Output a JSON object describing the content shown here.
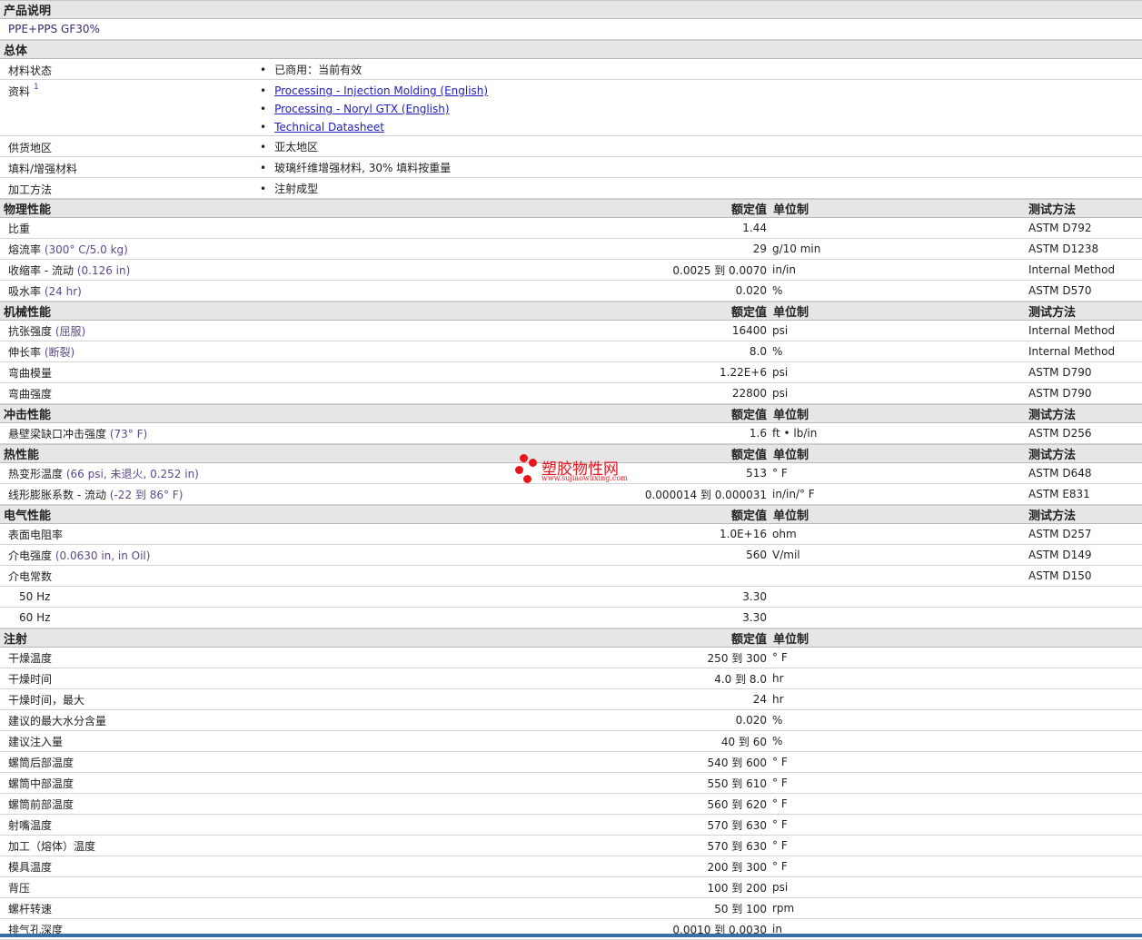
{
  "product": {
    "title": "产品说明",
    "desc": "PPE+PPS GF30%"
  },
  "general": {
    "title": "总体",
    "rows": [
      {
        "name": "材料状态",
        "items": [
          "已商用：当前有效"
        ]
      },
      {
        "name": "资料",
        "sup": "1",
        "links": [
          "Processing - Injection Molding (English)",
          "Processing - Noryl GTX (English)",
          "Technical Datasheet"
        ]
      },
      {
        "name": "供货地区",
        "items": [
          "亚太地区"
        ]
      },
      {
        "name": "填料/增强材料",
        "items": [
          "玻璃纤维增强材料, 30% 填料按重量"
        ]
      },
      {
        "name": "加工方法",
        "items": [
          "注射成型"
        ]
      }
    ]
  },
  "cols": {
    "value": "额定值",
    "unit": "单位制",
    "method": "测试方法"
  },
  "sections": [
    {
      "title": "物理性能",
      "rows": [
        {
          "name": "比重",
          "cond": "",
          "value": "1.44",
          "unit": "",
          "method": "ASTM D792"
        },
        {
          "name": "熔流率",
          "cond": "(300° C/5.0 kg)",
          "value": "29",
          "unit": "g/10 min",
          "method": "ASTM D1238"
        },
        {
          "name": "收缩率 - 流动",
          "cond": "(0.126 in)",
          "value": "0.0025 到 0.0070",
          "unit": "in/in",
          "method": "Internal Method"
        },
        {
          "name": "吸水率",
          "cond": "(24 hr)",
          "value": "0.020",
          "unit": "%",
          "method": "ASTM D570"
        }
      ]
    },
    {
      "title": "机械性能",
      "rows": [
        {
          "name": "抗张强度",
          "cond": "(屈服)",
          "value": "16400",
          "unit": "psi",
          "method": "Internal Method"
        },
        {
          "name": "伸长率",
          "cond": "(断裂)",
          "value": "8.0",
          "unit": "%",
          "method": "Internal Method"
        },
        {
          "name": "弯曲模量",
          "cond": "",
          "value": "1.22E+6",
          "unit": "psi",
          "method": "ASTM D790"
        },
        {
          "name": "弯曲强度",
          "cond": "",
          "value": "22800",
          "unit": "psi",
          "method": "ASTM D790"
        }
      ]
    },
    {
      "title": "冲击性能",
      "rows": [
        {
          "name": "悬壁梁缺口冲击强度",
          "cond": "(73° F)",
          "value": "1.6",
          "unit": "ft • lb/in",
          "method": "ASTM D256"
        }
      ]
    },
    {
      "title": "热性能",
      "rows": [
        {
          "name": "热变形温度",
          "cond": "(66 psi, 未退火, 0.252 in)",
          "value": "513",
          "unit": "° F",
          "method": "ASTM D648"
        },
        {
          "name": "线形膨胀系数 - 流动",
          "cond": "(-22 到 86° F)",
          "value": "0.000014 到 0.000031",
          "unit": "in/in/° F",
          "method": "ASTM E831"
        }
      ]
    },
    {
      "title": "电气性能",
      "rows": [
        {
          "name": "表面电阻率",
          "cond": "",
          "value": "1.0E+16",
          "unit": "ohm",
          "method": "ASTM D257"
        },
        {
          "name": "介电强度",
          "cond": "(0.0630 in, in Oil)",
          "value": "560",
          "unit": "V/mil",
          "method": "ASTM D149"
        },
        {
          "name": "介电常数",
          "cond": "",
          "value": "",
          "unit": "",
          "method": "ASTM D150"
        },
        {
          "name": "50 Hz",
          "sub": true,
          "cond": "",
          "value": "3.30",
          "unit": "",
          "method": ""
        },
        {
          "name": "60 Hz",
          "sub": true,
          "cond": "",
          "value": "3.30",
          "unit": "",
          "method": ""
        }
      ]
    },
    {
      "title": "注射",
      "nomethod": true,
      "rows": [
        {
          "name": "干燥温度",
          "cond": "",
          "value": "250 到 300",
          "unit": "° F",
          "method": ""
        },
        {
          "name": "干燥时间",
          "cond": "",
          "value": "4.0 到 8.0",
          "unit": "hr",
          "method": ""
        },
        {
          "name": "干燥时间，最大",
          "cond": "",
          "value": "24",
          "unit": "hr",
          "method": ""
        },
        {
          "name": "建议的最大水分含量",
          "cond": "",
          "value": "0.020",
          "unit": "%",
          "method": ""
        },
        {
          "name": "建议注入量",
          "cond": "",
          "value": "40 到 60",
          "unit": "%",
          "method": ""
        },
        {
          "name": "螺筒后部温度",
          "cond": "",
          "value": "540 到 600",
          "unit": "° F",
          "method": ""
        },
        {
          "name": "螺筒中部温度",
          "cond": "",
          "value": "550 到 610",
          "unit": "° F",
          "method": ""
        },
        {
          "name": "螺筒前部温度",
          "cond": "",
          "value": "560 到 620",
          "unit": "° F",
          "method": ""
        },
        {
          "name": "射嘴温度",
          "cond": "",
          "value": "570 到 630",
          "unit": "° F",
          "method": ""
        },
        {
          "name": "加工（熔体）温度",
          "cond": "",
          "value": "570 到 630",
          "unit": "° F",
          "method": ""
        },
        {
          "name": "模具温度",
          "cond": "",
          "value": "200 到 300",
          "unit": "° F",
          "method": ""
        },
        {
          "name": "背压",
          "cond": "",
          "value": "100 到 200",
          "unit": "psi",
          "method": ""
        },
        {
          "name": "螺杆转速",
          "cond": "",
          "value": "50 到 100",
          "unit": "rpm",
          "method": ""
        },
        {
          "name": "排气孔深度",
          "cond": "",
          "value": "0.0010 到 0.0030",
          "unit": "in",
          "method": ""
        }
      ]
    }
  ],
  "watermark": {
    "name": "塑胶物性网",
    "url": "www.sujiaowuxing.com"
  }
}
